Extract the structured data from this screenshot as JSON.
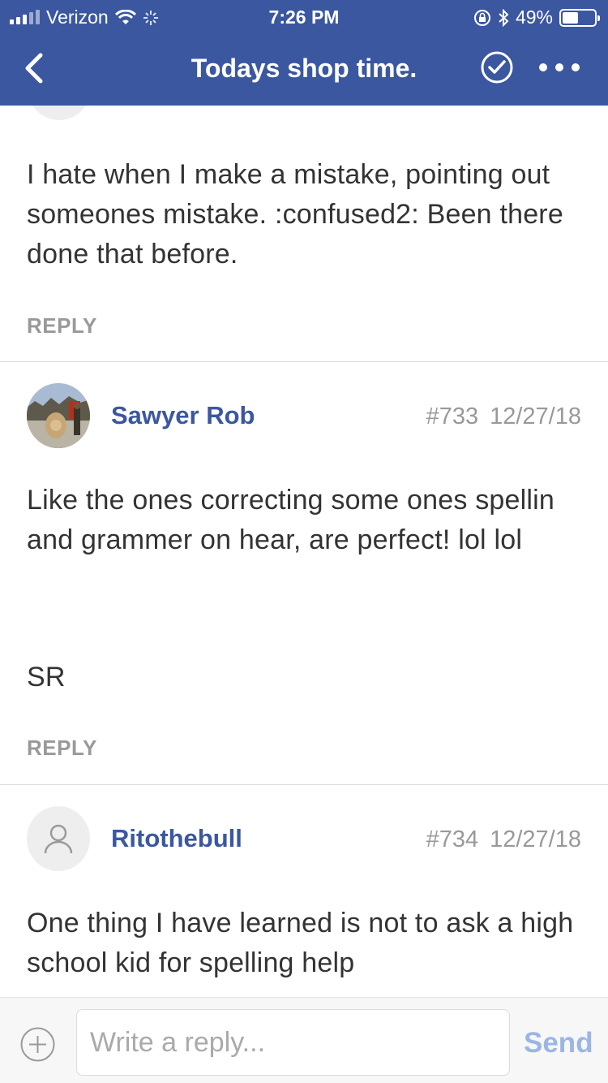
{
  "status": {
    "carrier": "Verizon",
    "time": "7:26 PM",
    "battery": "49%",
    "battery_level": 0.49
  },
  "nav": {
    "title": "Todays shop time."
  },
  "posts": [
    {
      "text": "I hate when I make a mistake, pointing out someones mistake. :confused2: Been there done that before.",
      "reply": "REPLY"
    },
    {
      "username": "Sawyer Rob",
      "number": "#733",
      "date": "12/27/18",
      "text": "Like the ones correcting some ones spellin and grammer on hear, are perfect! lol lol",
      "signature": "SR",
      "reply": "REPLY"
    },
    {
      "username": "Ritothebull",
      "number": "#734",
      "date": "12/27/18",
      "text": "One thing I have learned is not to ask a high school kid for spelling help"
    }
  ],
  "composer": {
    "placeholder": "Write a reply...",
    "send_label": "Send"
  },
  "colors": {
    "brand": "#3b57a0",
    "send_disabled": "#9bb6e4",
    "muted": "#999999"
  },
  "icons": [
    "back-chevron-icon",
    "check-circle-icon",
    "more-icon",
    "user-placeholder-icon",
    "add-circle-icon",
    "wifi-icon",
    "bluetooth-icon",
    "orientation-lock-icon"
  ]
}
